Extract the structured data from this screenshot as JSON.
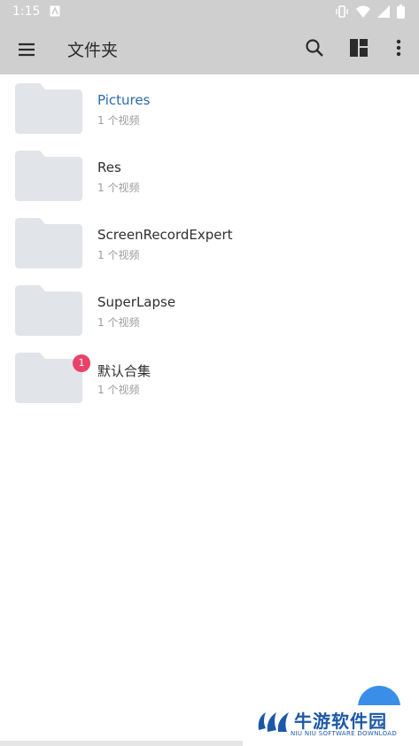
{
  "status_bar": {
    "time": "1:15"
  },
  "app_bar": {
    "title": "文件夹"
  },
  "folders": [
    {
      "name": "Pictures",
      "count": "1 个视频",
      "active": true,
      "badge": ""
    },
    {
      "name": "Res",
      "count": "1 个视频",
      "active": false,
      "badge": ""
    },
    {
      "name": "ScreenRecordExpert",
      "count": "1 个视频",
      "active": false,
      "badge": ""
    },
    {
      "name": "SuperLapse",
      "count": "1 个视频",
      "active": false,
      "badge": ""
    },
    {
      "name": "默认合集",
      "count": "1 个视频",
      "active": false,
      "badge": "1"
    }
  ],
  "watermark": {
    "name": "牛游软件园",
    "sub": "NIU NIU SOFTWARE DOWNLOAD"
  },
  "colors": {
    "accent": "#2a6aa8",
    "badge": "#e8436a",
    "fab": "#3b8ee8",
    "toolbar": "#cfcfcf",
    "folder": "#e1e4e8"
  }
}
